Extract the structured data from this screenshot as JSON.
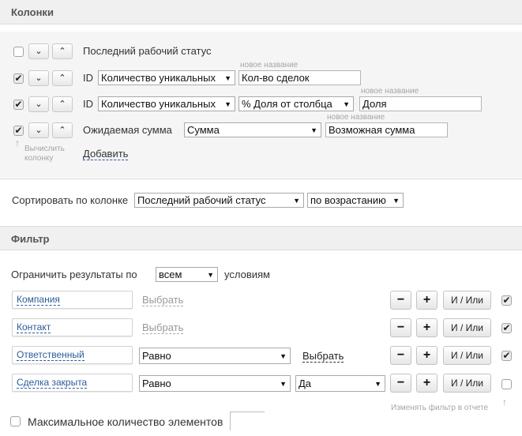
{
  "columns": {
    "header": "Колонки",
    "rows": [
      {
        "checked": false,
        "checkmark": "",
        "label": "Последний рабочий статус"
      },
      {
        "checked": true,
        "checkmark": "✔",
        "prefix": "ID",
        "aggregate": "Количество уникальных",
        "hint": "новое название",
        "name": "Кол-во сделок"
      },
      {
        "checked": true,
        "checkmark": "✔",
        "prefix": "ID",
        "aggregate": "Количество уникальных",
        "extra": "% Доля от столбца",
        "hint": "новое название",
        "name": "Доля"
      },
      {
        "checked": true,
        "checkmark": "✔",
        "label": "Ожидаемая сумма",
        "aggregate": "Сумма",
        "hint": "новое название",
        "name": "Возможная сумма"
      }
    ],
    "calc_arrow": "↑",
    "calc_hint_line1": "Вычислить",
    "calc_hint_line2": "колонку",
    "add_link": "Добавить",
    "down_glyph": "⌄",
    "up_glyph": "⌃"
  },
  "sort": {
    "label": "Сортировать по колонке",
    "column": "Последний рабочий статус",
    "direction": "по возрастанию"
  },
  "filter": {
    "header": "Фильтр",
    "limit_prefix": "Ограничить результаты по",
    "limit_value": "всем",
    "limit_suffix": "условиям",
    "rows": [
      {
        "field": "Компания",
        "choose": "Выбрать",
        "checked": true,
        "checkmark": "✔"
      },
      {
        "field": "Контакт",
        "choose": "Выбрать",
        "checked": true,
        "checkmark": "✔"
      },
      {
        "field": "Ответственный",
        "operator": "Равно",
        "choose": "Выбрать",
        "checked": true,
        "checkmark": "✔"
      },
      {
        "field": "Сделка закрыта",
        "operator": "Равно",
        "value": "Да",
        "checked": false,
        "checkmark": ""
      }
    ],
    "minus": "−",
    "plus": "+",
    "andor": "И / Или",
    "edit_hint": "Изменять фильтр в отчете",
    "edit_arrow": "↑",
    "max_label": "Максимальное количество элементов"
  },
  "arrow_glyph": "▼"
}
